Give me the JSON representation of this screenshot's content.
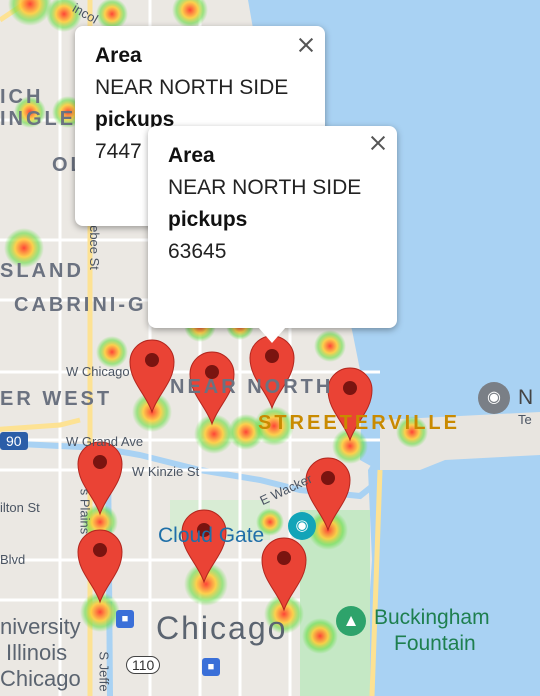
{
  "labels": {
    "inch": "ICH",
    "ingle": "INGLE",
    "island": "SLAND",
    "cabrini": "CABRINI-G",
    "near_west": "ER WEST",
    "near_north": "NEAR NORTH",
    "streeterville": "STREETERVILLE",
    "ol": "OL",
    "w_chicago": "W Chicago",
    "w_grand": "W Grand Ave",
    "w_kinzie": "W Kinzie St",
    "e_wacker": "E Wacker",
    "ilton": "ilton St",
    "blvd": "Blvd",
    "cloud_gate": "Cloud Gate",
    "chicago": "Chicago",
    "univ": "niversity",
    "illinois": "Illinois",
    "chicago2": "Chicago",
    "buckingham1": "Buckingham",
    "buckingham2": "Fountain",
    "navy1": "N",
    "navy2": "Te",
    "sebee": "ebee St",
    "s_plains": "s Plains",
    "s_jeff": "S Jeffe",
    "hwy110": "110",
    "hwy90": "90",
    "lincoln": "incol"
  },
  "popups": [
    {
      "area_label": "Area",
      "area": "NEAR NORTH SIDE",
      "pickups_label": "pickups",
      "pickups": "7447"
    },
    {
      "area_label": "Area",
      "area": "NEAR NORTH SIDE",
      "pickups_label": "pickups",
      "pickups": "63645"
    }
  ],
  "colors": {
    "water": "#a9d2f3",
    "marker": "#ea4335",
    "park": "#c5e8c5"
  }
}
